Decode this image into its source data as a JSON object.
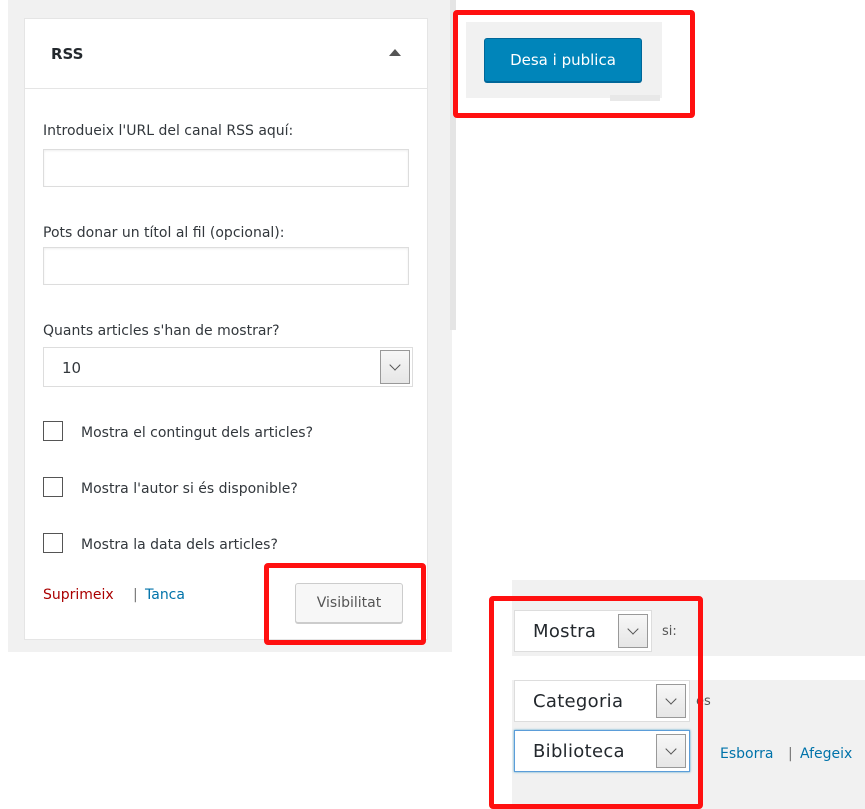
{
  "widget": {
    "title": "RSS",
    "url_label": "Introdueix l'URL del canal RSS aquí:",
    "url_value": "",
    "title_label": "Pots donar un títol al fil (opcional):",
    "title_value": "",
    "count_label": "Quants articles s'han de mostrar?",
    "count_value": "10",
    "checkboxes": [
      {
        "label": "Mostra el contingut dels articles?",
        "checked": false
      },
      {
        "label": "Mostra l'autor si és disponible?",
        "checked": false
      },
      {
        "label": "Mostra la data dels articles?",
        "checked": false
      }
    ],
    "delete_link": "Suprimeix",
    "separator": "|",
    "close_link": "Tanca",
    "visibility_button": "Visibilitat"
  },
  "publish": {
    "button": "Desa i publica"
  },
  "rules": {
    "action_value": "Mostra",
    "if_text": "si:",
    "type_value": "Categoria",
    "is_text": "és",
    "value_value": "Biblioteca",
    "delete_link": "Esborra",
    "separator": "|",
    "add_link": "Afegeix"
  },
  "colors": {
    "primary": "#0085ba",
    "link": "#0073aa",
    "delete": "#a00",
    "highlight": "#ff1010"
  }
}
